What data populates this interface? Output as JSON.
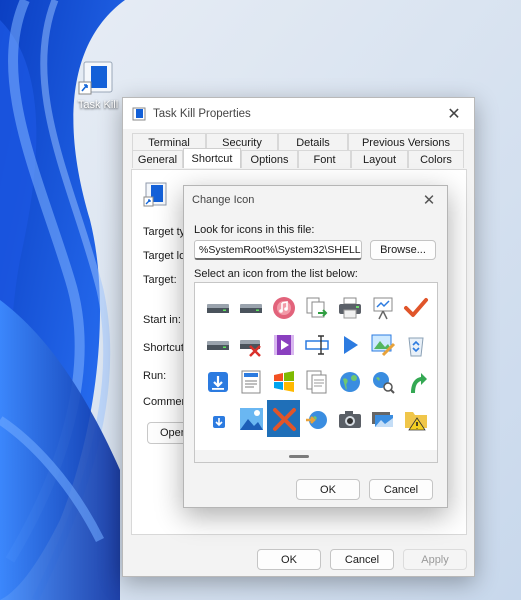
{
  "desktop": {
    "shortcut_label": "Task Kill",
    "accent": "#1360d8"
  },
  "properties": {
    "title": "Task Kill Properties",
    "tabs_row1": [
      "Terminal",
      "Security",
      "Details",
      "Previous Versions"
    ],
    "tabs_row2": [
      "General",
      "Shortcut",
      "Options",
      "Font",
      "Layout",
      "Colors"
    ],
    "active_tab": "Shortcut",
    "fields": {
      "target_type": "Target typ",
      "target_location": "Target loc",
      "target": "Target:",
      "start_in": "Start in:",
      "shortcut_key": "Shortcut k",
      "run": "Run:",
      "comment": "Comment:"
    },
    "open_button": "Open",
    "buttons": {
      "ok": "OK",
      "cancel": "Cancel",
      "apply": "Apply"
    }
  },
  "change_icon": {
    "title": "Change Icon",
    "look_label": "Look for icons in this file:",
    "path_value": "%SystemRoot%\\System32\\SHELL32.dll",
    "browse": "Browse...",
    "select_label": "Select an icon from the list below:",
    "icons": [
      "drive-icon",
      "drive-icon",
      "music-disc-icon",
      "copy-document-icon",
      "printer-icon",
      "presentation-icon",
      "checkmark-icon",
      "device-icon",
      "drive-icon",
      "drive-error-icon",
      "video-icon",
      "rename-icon",
      "play-icon",
      "image-edit-icon",
      "recycle-bin-icon",
      "drive-icon",
      "download-icon",
      "document-icon",
      "windows-logo-icon",
      "documents-icon",
      "globe-icon",
      "globe-search-icon",
      "green-arrow-icon",
      "user-icon",
      "small-download-icon",
      "image-icon",
      "delete-x-icon",
      "globe-arrow-icon",
      "camera-icon",
      "stacked-images-icon",
      "folder-warning-icon",
      "disc-icon"
    ],
    "selected_index": 26,
    "ok": "OK",
    "cancel": "Cancel"
  }
}
